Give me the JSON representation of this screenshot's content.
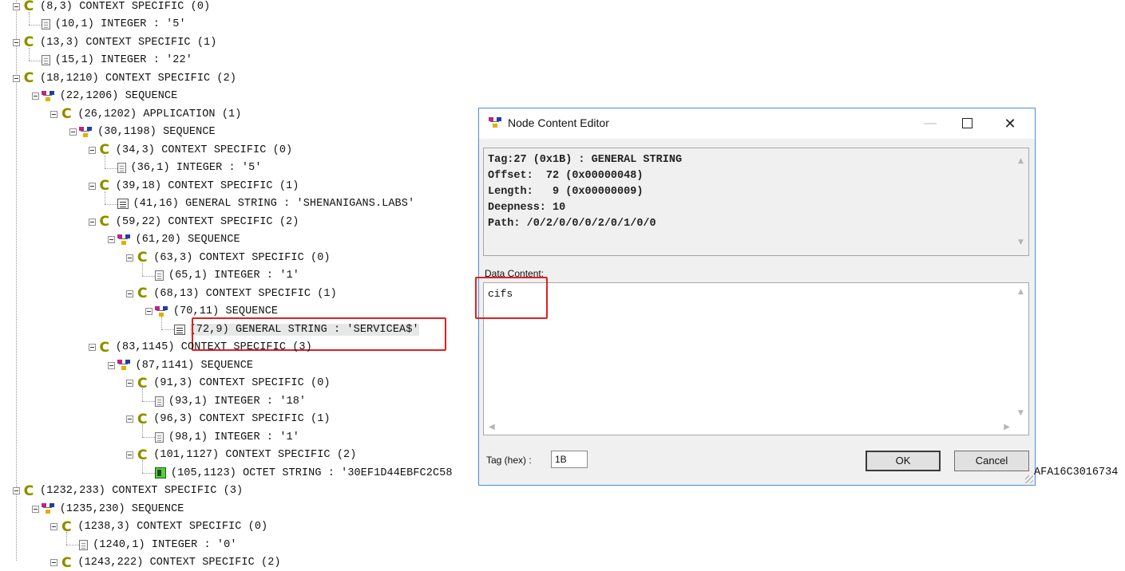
{
  "tree": {
    "nodes": [
      {
        "label": "(8,3) CONTEXT SPECIFIC (0)"
      },
      {
        "label": "(10,1) INTEGER : '5'"
      },
      {
        "label": "(13,3) CONTEXT SPECIFIC (1)"
      },
      {
        "label": "(15,1) INTEGER : '22'"
      },
      {
        "label": "(18,1210) CONTEXT SPECIFIC (2)"
      },
      {
        "label": "(22,1206) SEQUENCE"
      },
      {
        "label": "(26,1202) APPLICATION (1)"
      },
      {
        "label": "(30,1198) SEQUENCE"
      },
      {
        "label": "(34,3) CONTEXT SPECIFIC (0)"
      },
      {
        "label": "(36,1) INTEGER : '5'"
      },
      {
        "label": "(39,18) CONTEXT SPECIFIC (1)"
      },
      {
        "label": "(41,16) GENERAL STRING : 'SHENANIGANS.LABS'"
      },
      {
        "label": "(59,22) CONTEXT SPECIFIC (2)"
      },
      {
        "label": "(61,20) SEQUENCE"
      },
      {
        "label": "(63,3) CONTEXT SPECIFIC (0)"
      },
      {
        "label": "(65,1) INTEGER : '1'"
      },
      {
        "label": "(68,13) CONTEXT SPECIFIC (1)"
      },
      {
        "label": "(70,11) SEQUENCE"
      },
      {
        "label": "(72,9) GENERAL STRING : 'SERVICEA$'"
      },
      {
        "label": "(83,1145) CONTEXT SPECIFIC (3)"
      },
      {
        "label": "(87,1141) SEQUENCE"
      },
      {
        "label": "(91,3) CONTEXT SPECIFIC (0)"
      },
      {
        "label": "(93,1) INTEGER : '18'"
      },
      {
        "label": "(96,3) CONTEXT SPECIFIC (1)"
      },
      {
        "label": "(98,1) INTEGER : '1'"
      },
      {
        "label": "(101,1127) CONTEXT SPECIFIC (2)"
      },
      {
        "label": "(105,1123) OCTET STRING : '30EF1D44EBFC2C58"
      },
      {
        "label": "(1232,233) CONTEXT SPECIFIC (3)"
      },
      {
        "label": "(1235,230) SEQUENCE"
      },
      {
        "label": "(1238,3) CONTEXT SPECIFIC (0)"
      },
      {
        "label": "(1240,1) INTEGER : '0'"
      },
      {
        "label": "(1243,222) CONTEXT SPECIFIC (2)"
      }
    ],
    "octet_tail": "AFA16C3016734"
  },
  "dialog": {
    "title": "Node Content Editor",
    "info": {
      "tag": "Tag:27 (0x1B) : GENERAL STRING",
      "offset": "Offset:  72 (0x00000048)",
      "length": "Length:   9 (0x00000009)",
      "deepness": "Deepness: 10",
      "path": "Path: /0/2/0/0/0/2/0/1/0/0"
    },
    "data_label": "Data Content:",
    "data_value": "cifs",
    "tag_label": "Tag (hex) :",
    "tag_value": "1B",
    "ok_label": "OK",
    "cancel_label": "Cancel"
  }
}
